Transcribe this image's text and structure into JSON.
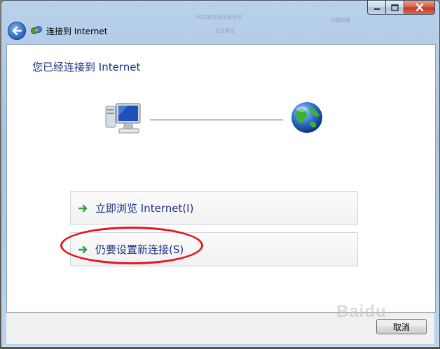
{
  "window": {
    "title": "连接到 Internet",
    "background_ghost_text": [
      "PC的域名和系统名称",
      "显示属性",
      "设置管理"
    ]
  },
  "main": {
    "heading": "您已经连接到 Internet",
    "options": [
      {
        "label": "立即浏览 Internet(I)",
        "icon": "green-arrow-icon"
      },
      {
        "label": "仍要设置新连接(S)",
        "icon": "green-arrow-icon"
      }
    ],
    "highlight_color": "#e4161d"
  },
  "footer": {
    "cancel_label": "取消"
  },
  "watermark": {
    "text": "Baidu"
  },
  "colors": {
    "link": "#1e3287",
    "window_frame": "#b9d1ea",
    "close_button": "#c23a22"
  }
}
